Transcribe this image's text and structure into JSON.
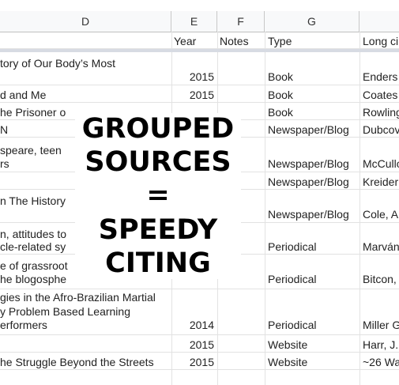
{
  "columns": {
    "letters": [
      "D",
      "E",
      "F",
      "G",
      ""
    ],
    "headers": [
      "",
      "Year",
      "Notes",
      "Type",
      "Long ci"
    ]
  },
  "rows": [
    {
      "d": [
        "tory of Our Body’s Most"
      ],
      "year": "2015",
      "type": "Book",
      "cite": "Enders"
    },
    {
      "d": [
        "d and Me"
      ],
      "year": "2015",
      "type": "Book",
      "cite": "Coates"
    },
    {
      "d": [
        "he Prisoner o"
      ],
      "year": "",
      "type": "Book",
      "cite": "Rowling"
    },
    {
      "d": [
        "N"
      ],
      "year": "",
      "type": "Newspaper/Blog",
      "cite": "Dubcov"
    },
    {
      "d": [
        "speare, teen",
        "rs"
      ],
      "year": "",
      "type": "Newspaper/Blog",
      "cite": "McCullo"
    },
    {
      "d": [
        ""
      ],
      "year": "",
      "type": "Newspaper/Blog",
      "cite": "Kreider"
    },
    {
      "d": [
        "n The History"
      ],
      "year": "",
      "type": "Newspaper/Blog",
      "cite": "Cole, A"
    },
    {
      "d": [
        "n, attitudes to",
        "cle-related sy"
      ],
      "year": "",
      "type": "Periodical",
      "cite": "Marván"
    },
    {
      "d": [
        "e of grassroot",
        "he blogosphe"
      ],
      "year": "",
      "type": "Periodical",
      "cite": "Bitcon,"
    },
    {
      "d": [
        "gies in the Afro-Brazilian Martial",
        "y Problem Based Learning",
        "erformers"
      ],
      "year": "2014",
      "type": "Periodical",
      "cite": "Miller G"
    },
    {
      "d": [
        ""
      ],
      "year": "2015",
      "type": "Website",
      "cite": "Harr, J."
    },
    {
      "d": [
        "he Struggle Beyond the Streets"
      ],
      "year": "2015",
      "type": "Website",
      "cite": "~26 Wa"
    }
  ],
  "overlay": {
    "lines": [
      "GROUPED",
      "SOURCES",
      "=",
      "SPEEDY",
      "CITING"
    ]
  }
}
